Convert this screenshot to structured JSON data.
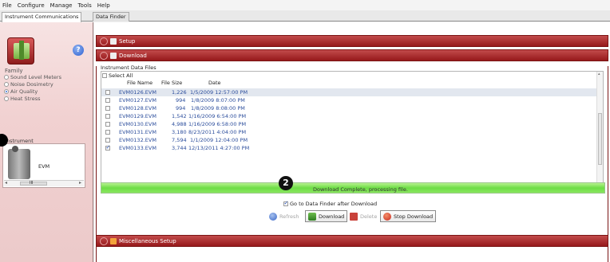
{
  "menu": [
    "File",
    "Configure",
    "Manage",
    "Tools",
    "Help"
  ],
  "tabs": [
    "Instrument Communications",
    "Data Finder"
  ],
  "sidebar": {
    "family_label": "Family",
    "families": [
      {
        "label": "Sound Level Meters",
        "selected": false
      },
      {
        "label": "Noise Dosimetry",
        "selected": false
      },
      {
        "label": "Air Quality",
        "selected": true
      },
      {
        "label": "Heat Stress",
        "selected": false
      }
    ],
    "instrument_label": "Instrument",
    "instrument_name": "EVM",
    "scroll_left": "◂",
    "scroll_mid": "III",
    "scroll_right": "▸",
    "help_glyph": "?"
  },
  "sections": {
    "setup": "Setup",
    "download": "Download",
    "misc": "Miscellaneous Setup"
  },
  "download": {
    "files_label": "Instrument Data Files",
    "select_all": "Select All",
    "columns": [
      "File Name",
      "File Size",
      "Date"
    ],
    "files": [
      {
        "name": "EVM0126.EVM",
        "size": "1,226",
        "date": "1/5/2009 12:57:00 PM",
        "checked": false
      },
      {
        "name": "EVM0127.EVM",
        "size": "994",
        "date": "1/8/2009 8:07:00 PM",
        "checked": false
      },
      {
        "name": "EVM0128.EVM",
        "size": "994",
        "date": "1/8/2009 8:08:00 PM",
        "checked": false
      },
      {
        "name": "EVM0129.EVM",
        "size": "1,542",
        "date": "1/16/2009 6:54:00 PM",
        "checked": false
      },
      {
        "name": "EVM0130.EVM",
        "size": "4,988",
        "date": "1/16/2009 6:58:00 PM",
        "checked": false
      },
      {
        "name": "EVM0131.EVM",
        "size": "3,180",
        "date": "8/23/2011 4:04:00 PM",
        "checked": false
      },
      {
        "name": "EVM0132.EVM",
        "size": "7,594",
        "date": "1/1/2009 12:04:00 PM",
        "checked": false
      },
      {
        "name": "EVM0133.EVM",
        "size": "3,744",
        "date": "12/13/2011 4:27:00 PM",
        "checked": true
      }
    ],
    "status": "Download Complete, processing file.",
    "progress_fraction": 1.0,
    "callout_number": "2",
    "goto_label": "Go to Data Finder after Download",
    "goto_checked": true,
    "buttons": {
      "refresh": "Refresh",
      "download": "Download",
      "delete": "Delete",
      "stop": "Stop Download"
    }
  },
  "colors": {
    "section_header": "#96191b",
    "progress": "#6ddd45",
    "sidebar_bg": "#f1d1d1"
  }
}
